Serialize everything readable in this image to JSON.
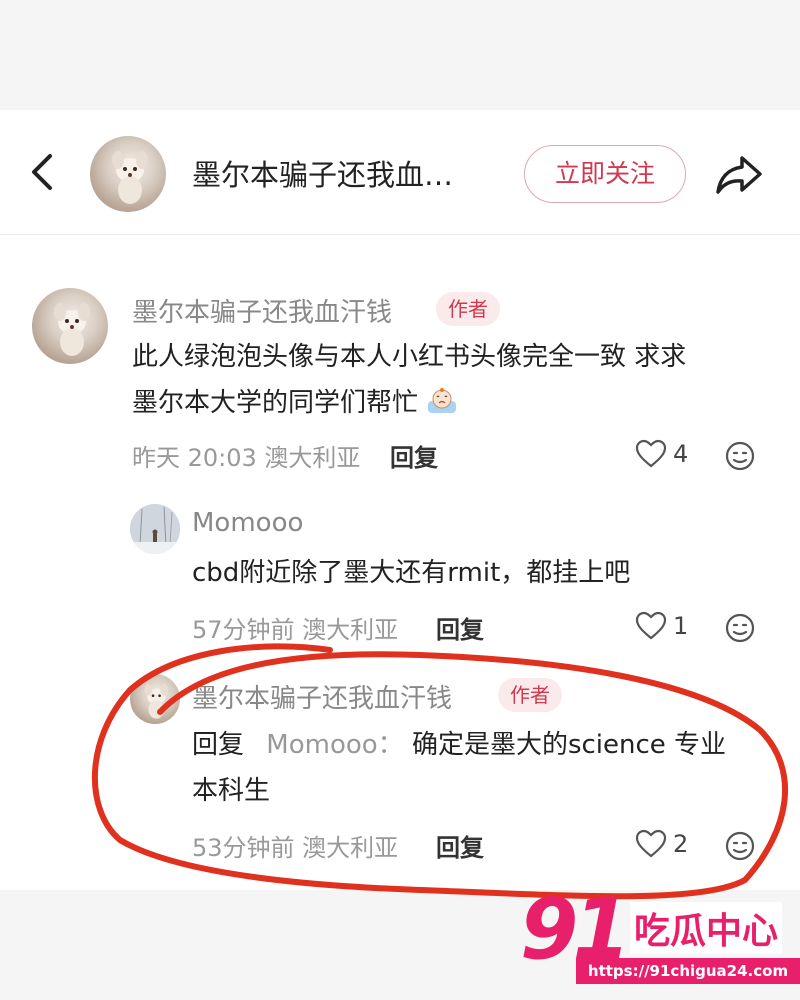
{
  "header": {
    "title": "墨尔本骗子还我血…",
    "follow_label": "立即关注"
  },
  "comments": [
    {
      "author": "墨尔本骗子还我血汗钱",
      "badge": "作者",
      "text_line1": "此人绿泡泡头像与本人小红书头像完全一致 求求",
      "text_line2": "墨尔本大学的同学们帮忙",
      "time_location": "昨天 20:03 澳大利亚",
      "reply_label": "回复",
      "likes": "4"
    },
    {
      "author": "Momooo",
      "text": "cbd附近除了墨大还有rmit，都挂上吧",
      "time_location": "57分钟前 澳大利亚",
      "reply_label": "回复",
      "likes": "1"
    },
    {
      "author": "墨尔本骗子还我血汗钱",
      "badge": "作者",
      "reply_prefix": "回复",
      "reply_to": "Momooo：",
      "text_line1": "确定是墨大的science 专业",
      "text_line2": "本科生",
      "time_location": "53分钟前 澳大利亚",
      "reply_label": "回复",
      "likes": "2"
    }
  ],
  "watermark": {
    "number": "91",
    "text": "吃瓜中心",
    "url": "https://91chigua24.com"
  },
  "colors": {
    "accent": "#d13a4e",
    "annotation": "#e0301e",
    "watermark": "#e8206c"
  },
  "icons": [
    "back-arrow-icon",
    "share-icon",
    "heart-icon",
    "emoji-icon",
    "crying-emoji-icon"
  ]
}
